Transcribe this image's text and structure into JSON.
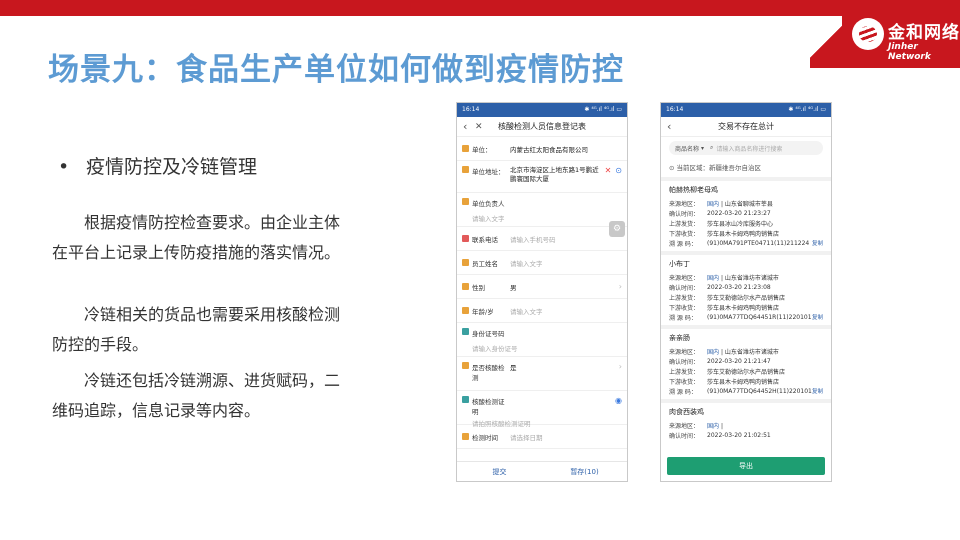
{
  "brand": {
    "cn": "金和网络",
    "en": "Jinher Network"
  },
  "title": "场景九：食品生产单位如何做到疫情防控",
  "bullet": "疫情防控及冷链管理",
  "paragraphs": [
    "根据疫情防控检查要求。由企业主体在平台上记录上传防疫措施的落实情况。",
    "冷链相关的货品也需要采用核酸检测防控的手段。",
    "冷链还包括冷链溯源、进货赋码，二维码追踪，信息记录等内容。"
  ],
  "phone_left": {
    "status_time": "16:14",
    "status_right": "✱ ⁴ᴳ.ıl ⁴ᴳ.ıl ▭",
    "title": "核酸检测人员信息登记表",
    "fields": {
      "unit_label": "单位：",
      "unit_value": "内蒙古红太阳食品有限公司",
      "address_label": "单位地址：",
      "address_value": "北京市海淀区上地东路1号鹏近鹏寰国际大厦",
      "owner_label": "单位负责人",
      "owner_placeholder": "请输入文字",
      "phone_label": "联系电话",
      "phone_placeholder": "请输入手机号码",
      "name_label": "员工姓名",
      "name_placeholder": "请输入文字",
      "gender_label": "性别",
      "gender_value": "男",
      "age_label": "年龄/岁",
      "age_placeholder": "请输入文字",
      "id_label": "身份证号码",
      "id_placeholder": "请输入身份证号",
      "tested_label": "是否核酸检测",
      "tested_value": "是",
      "cert_label": "核酸检测证明",
      "cert_placeholder": "请拍照核酸检测证明",
      "time_label": "检测时间",
      "time_placeholder": "请选择日期"
    },
    "submit": "提交",
    "save": "暂存(10)"
  },
  "phone_right": {
    "status_time": "16:14",
    "status_right": "✱ ⁴ᴳ.ıl ⁴ᴳ.ıl ▭",
    "title": "交易不存在总计",
    "search_dropdown": "商品名称",
    "search_placeholder": "请输入商品名称进行搜索",
    "region": "当前区域：新疆维吾尔自治区",
    "labels": {
      "source": "来源地区：",
      "confirm": "确认时间：",
      "upstream": "上游发货：",
      "downstream": "下游收货：",
      "code": "溯 源 码：",
      "copy": "复制"
    },
    "cards": [
      {
        "name": "帕赫热柳老母鸡",
        "source_tag": "国内",
        "source": "| 山东省聊城市莘县",
        "confirm": "2022-03-20 21:23:27",
        "upstream": "莎车县冰山冷库服务中心",
        "downstream": "莎车县木卡姆鸡鸭肉销售店",
        "code": "(91)0MA791PTE04711(11)211224"
      },
      {
        "name": "小布丁",
        "source_tag": "国内",
        "source": "| 山东省潍坊市诸城市",
        "confirm": "2022-03-20 21:23:08",
        "upstream": "莎车艾勒德站尔水产品销售店",
        "downstream": "莎车县木卡姆鸡鸭肉销售店",
        "code": "(91)0MA77TDQ64451R(11)220101"
      },
      {
        "name": "亲亲肠",
        "source_tag": "国内",
        "source": "| 山东省潍坊市诸城市",
        "confirm": "2022-03-20 21:21:47",
        "upstream": "莎车艾勒德站尔水产品销售店",
        "downstream": "莎车县木卡姆鸡鸭肉销售店",
        "code": "(91)0MA77TDQ64452H(11)220101"
      },
      {
        "name": "肉食西装鸡",
        "source_tag": "国内",
        "source": "|",
        "confirm": "2022-03-20 21:02:51"
      }
    ],
    "export": "导出"
  }
}
